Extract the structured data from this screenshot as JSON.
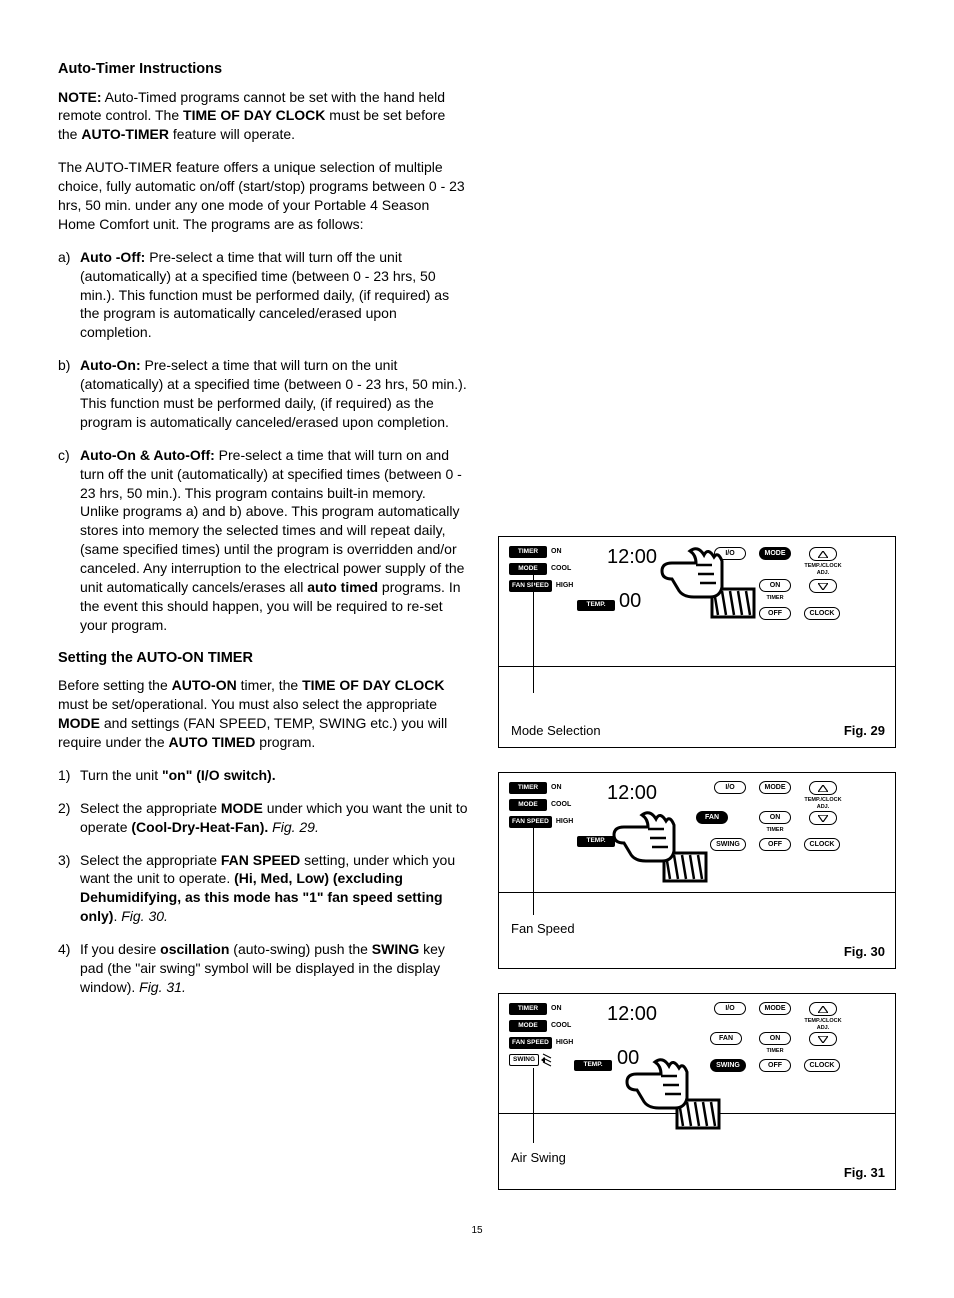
{
  "section1_title": "Auto-Timer Instructions",
  "note_label": "NOTE:",
  "note_p1a": "  Auto-Timed programs cannot be set with the hand held remote control.  The ",
  "note_b1": "TIME OF DAY CLOCK",
  "note_p1b": " must be set before the ",
  "note_b2": "AUTO-TIMER",
  "note_p1c": " feature will operate.",
  "intro_p": "The AUTO-TIMER feature offers a unique selection of multiple choice, fully automatic on/off (start/stop) programs between 0 - 23 hrs, 50 min. under any one mode of your Portable 4 Season Home Comfort unit.  The programs are as follows:",
  "li_a_mk": "a)",
  "li_a_b": "Auto -Off:",
  "li_a_t": "  Pre-select a time that will turn off the unit (automatically) at a specified time (between 0 - 23 hrs, 50 min.).  This function must be performed daily, (if required) as the program is automatically canceled/erased upon completion.",
  "li_b_mk": "b)",
  "li_b_b": "Auto-On:",
  "li_b_t": "  Pre-select a time that will turn on the unit (atomatically) at a specified time (between 0 - 23 hrs, 50 min.).  This function must be performed daily, (if required) as the program is automatically canceled/erased upon completion.",
  "li_c_mk": "c)",
  "li_c_b": "Auto-On & Auto-Off:",
  "li_c_t1": "  Pre-select a time that will turn on and turn off the unit (automatically) at specified times (between 0 - 23 hrs, 50 min.).  This program contains built-in memory.  Unlike programs a) and b) above.  This program automatically stores into memory the selected times and will repeat daily, (same specified times) until the program is overridden and/or canceled.  Any interruption to the electrical power supply of the unit automatically cancels/erases all ",
  "li_c_b2": "auto timed",
  "li_c_t2": " programs.  In the event this should happen, you will be required to re-set your program.",
  "section2_title": "Setting the AUTO-ON TIMER",
  "s2_p1a": "Before setting the ",
  "s2_b1": "AUTO-ON",
  "s2_p1b": " timer, the ",
  "s2_b2": "TIME OF DAY CLOCK",
  "s2_p1c": " must be set/operational.  You must also select the appropriate ",
  "s2_b3": "MODE",
  "s2_p1d": " and settings (FAN SPEED, TEMP, SWING etc.) you will require under the ",
  "s2_b4": "AUTO TIMED",
  "s2_p1e": " program.",
  "step1_mk": "1)",
  "step1_a": "Turn the unit ",
  "step1_b": "\"on\" (I/O switch).",
  "step2_mk": "2)",
  "step2_a": "Select the appropriate ",
  "step2_b": "MODE",
  "step2_c": " under which you want the unit to operate ",
  "step2_d": "(Cool-Dry-Heat-Fan).",
  "step2_e": "Fig. 29.",
  "step3_mk": "3)",
  "step3_a": "Select the appropriate ",
  "step3_b": "FAN SPEED",
  "step3_c": " setting, under which you want the unit to operate.  ",
  "step3_d": "(Hi, Med, Low) (excluding Dehumidifying, as this mode has \"1\" fan speed setting only)",
  "step3_e": ".  ",
  "step3_f": "Fig. 30.",
  "step4_mk": "4)",
  "step4_a": "If you desire ",
  "step4_b": "oscillation",
  "step4_c": " (auto-swing) push the ",
  "step4_d": "SWING",
  "step4_e": " key pad (the \"air swing\" symbol will be displayed in the display window).  ",
  "step4_f": "Fig. 31.",
  "lcd": {
    "timer": "TIMER",
    "on": "ON",
    "mode": "MODE",
    "cool": "COOL",
    "fanspeed": "FAN SPEED",
    "high": "HIGH",
    "temp": "TEMP.",
    "swing": "SWING",
    "time": "12:00",
    "tval": "00"
  },
  "btn": {
    "io": "I/O",
    "mode": "MODE",
    "fan": "FAN",
    "on": "ON",
    "swing": "SWING",
    "off": "OFF",
    "clock": "CLOCK",
    "timer": "TIMER",
    "adj": "TEMP./CLOCK ADJ."
  },
  "fig29_callout": "Mode Selection",
  "fig29_label": "Fig. 29",
  "fig30_callout": "Fan Speed",
  "fig30_label": "Fig. 30",
  "fig31_callout": "Air Swing",
  "fig31_label": "Fig. 31",
  "pagenum": "15"
}
